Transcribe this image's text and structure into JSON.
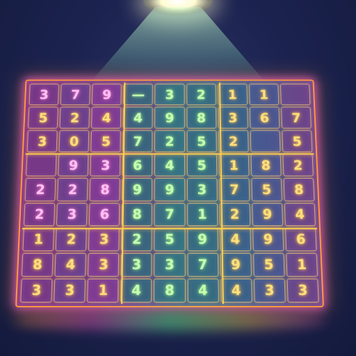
{
  "board": {
    "grid": [
      [
        "3",
        "7",
        "9",
        "—",
        "3",
        "2",
        "1",
        "1",
        ""
      ],
      [
        "5",
        "2",
        "4",
        "4",
        "9",
        "8",
        "3",
        "6",
        "7"
      ],
      [
        "3",
        "0",
        "5",
        "7",
        "2",
        "5",
        "2",
        "",
        "5"
      ],
      [
        "",
        "9",
        "3",
        "6",
        "4",
        "5",
        "1",
        "8",
        "2"
      ],
      [
        "2",
        "2",
        "8",
        "9",
        "9",
        "3",
        "7",
        "5",
        "8"
      ],
      [
        "2",
        "3",
        "6",
        "8",
        "7",
        "1",
        "2",
        "9",
        "4"
      ],
      [
        "1",
        "2",
        "3",
        "2",
        "5",
        "9",
        "4",
        "9",
        "6"
      ],
      [
        "8",
        "4",
        "3",
        "3",
        "3",
        "7",
        "9",
        "5",
        "1"
      ],
      [
        "3",
        "3",
        "1",
        "4",
        "8",
        "4",
        "4",
        "3",
        "3"
      ]
    ]
  },
  "colors": {
    "frame": "#ff9a3c",
    "digit": "#ffe07a",
    "glow": "#ff64c8"
  }
}
